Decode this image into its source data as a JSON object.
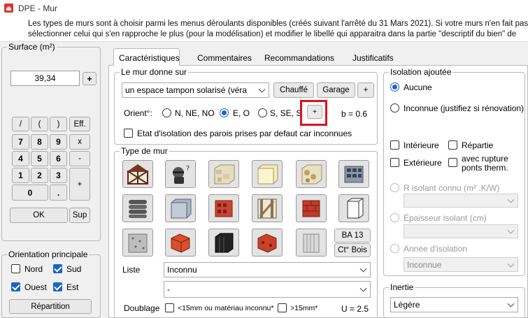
{
  "window": {
    "title": "DPE - Mur"
  },
  "info": {
    "line1": "Les types de murs sont à choisir parmi les menus déroulants disponibles (créés suivant l'arrêté du 31 Mars 2021). Si votre murs n'en fait pas p",
    "line2": "sélectionner celui qui s'en rapproche le plus (pour la modélisation) et modifier le libellé qui apparaitra dans la partie \"descriptif du bien\" de"
  },
  "surface": {
    "label": "Surface (m²)",
    "value": "39,34",
    "plus": "+",
    "keys": {
      "div": "/",
      "lpar": "(",
      "rpar": ")",
      "eff": "Eff.",
      "k7": "7",
      "k8": "8",
      "k9": "9",
      "mul": "x",
      "k4": "4",
      "k5": "5",
      "k6": "6",
      "minus": "-",
      "k1": "1",
      "k2": "2",
      "k3": "3",
      "add": "+",
      "k0": "0",
      "dot": "."
    },
    "ok": "OK",
    "sup": "Sup"
  },
  "orientation": {
    "label": "Orientation principale",
    "nord": "Nord",
    "sud": "Sud",
    "ouest": "Ouest",
    "est": "Est",
    "repartition": "Répartition"
  },
  "tabs": [
    "Caractéristiques",
    "Commentaires",
    "Recommandations",
    "Justificatifs"
  ],
  "mur": {
    "label": "Le mur donne sur",
    "select": "un espace tampon solarisé (véra",
    "chauffe": "Chauffé",
    "garage": "Garage",
    "plus": "+",
    "orient_label": "Orient°:",
    "o1": "N, NE, NO",
    "o2": "E, O",
    "o3": "S, SE, SO",
    "orient_plus": "+",
    "b": "b = 0.6",
    "etat": "Etat d'isolation des parois prises par defaut car inconnues"
  },
  "type": {
    "label": "Type de mur",
    "ba13": "BA 13",
    "ctbois": "Ct° Bois",
    "liste_label": "Liste",
    "liste_value": "Inconnu",
    "second_value": "-",
    "doublage_label": "Doublage",
    "d1": "<15mm ou matériau inconnu*",
    "d2": ">15mm*",
    "u": "U = 2.5"
  },
  "isolation": {
    "label": "Isolation ajoutée",
    "aucune": "Aucune",
    "inconnue": "Inconnue (justifiez si rénovation)",
    "interieure": "Intérieure",
    "repartie": "Répartie",
    "exterieure": "Extérieure",
    "rupture": "avec rupture",
    "ponts": "ponts therm.",
    "r": "R isolant connu (m² .K/W)",
    "epaisseur": "Épaisseur isolant (cm)",
    "annee": "Année d'isolation",
    "annee_value": "Inconnue"
  },
  "inertie": {
    "label": "Inertie",
    "value": "Légère"
  },
  "colors": {
    "accent": "#1a63c9",
    "highlight": "#e0101e"
  }
}
